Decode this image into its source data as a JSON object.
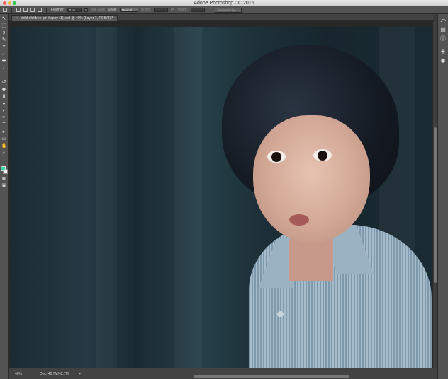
{
  "window": {
    "title": "Adobe Photoshop CC 2015"
  },
  "options_bar": {
    "feather_label": "Feather:",
    "feather_value": "0 px",
    "anti_alias_label": "Anti-alias",
    "style_label": "Style:",
    "style_value": "Normal",
    "width_label": "Width:",
    "height_label": "Height:",
    "refine_edge_label": "Refine Edge..."
  },
  "document": {
    "tab_title": "child-children-girl-happy (1).psd @ 40% (Layer 1, RGB/8) *"
  },
  "status": {
    "zoom": "40%",
    "doc_info": "Doc: 42.7M/42.7M"
  },
  "colors": {
    "foreground": "#3fd1a7",
    "background": "#ffffff",
    "accent": "#535353"
  },
  "tools": [
    "move-tool-icon",
    "marquee-tool-icon",
    "lasso-tool-icon",
    "quick-select-tool-icon",
    "crop-tool-icon",
    "eyedropper-tool-icon",
    "healing-brush-icon",
    "brush-tool-icon",
    "clone-stamp-icon",
    "history-brush-icon",
    "eraser-tool-icon",
    "gradient-tool-icon",
    "blur-tool-icon",
    "dodge-tool-icon",
    "pen-tool-icon",
    "type-tool-icon",
    "path-select-icon",
    "shape-tool-icon",
    "hand-tool-icon",
    "zoom-tool-icon"
  ]
}
